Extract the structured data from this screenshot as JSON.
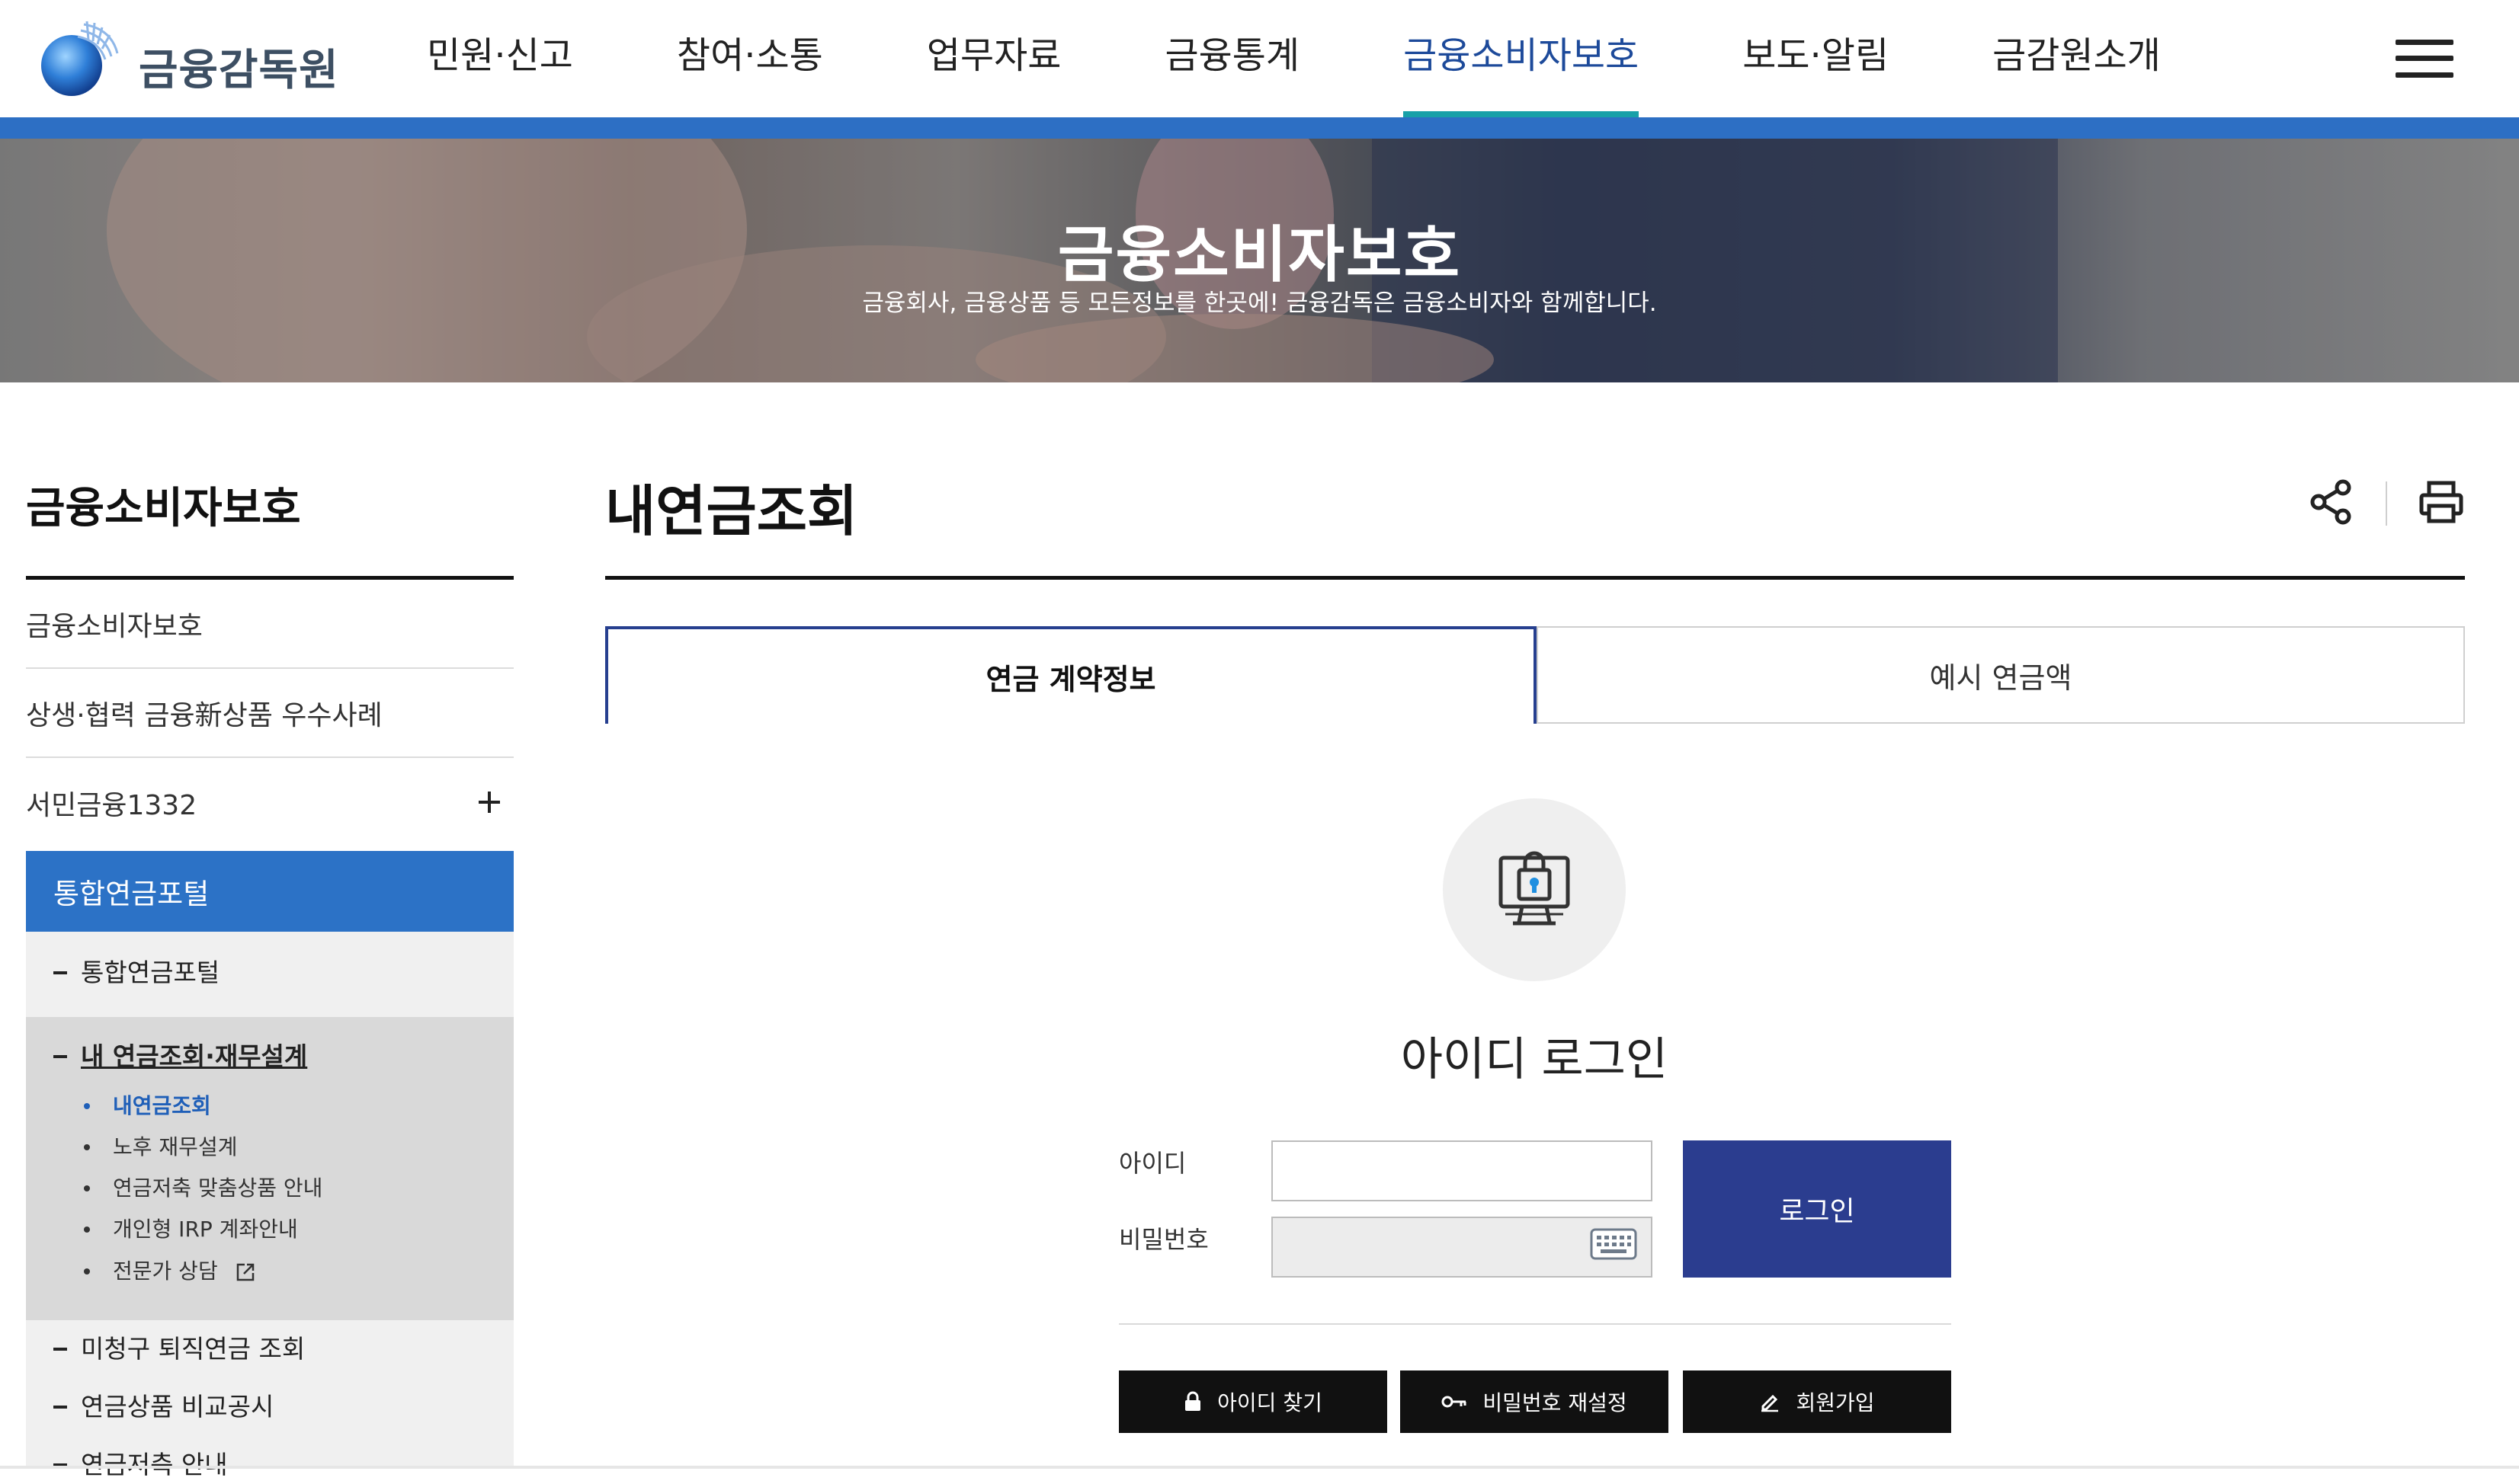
{
  "brand": {
    "name": "금융감독원"
  },
  "nav": {
    "items": [
      "민원·신고",
      "참여·소통",
      "업무자료",
      "금융통계",
      "금융소비자보호",
      "보도·알림",
      "금감원소개"
    ],
    "active_index": 4
  },
  "banner": {
    "title": "금융소비자보호",
    "subtitle": "금융회사, 금융상품 등 모든정보를 한곳에! 금융감독은 금융소비자와 함께합니다."
  },
  "sidebar": {
    "title": "금융소비자보호",
    "items": [
      "금융소비자보호",
      "상생·협력 금융新상품 우수사례",
      "서민금융1332"
    ],
    "active_section": "통합연금포털",
    "sub_items": [
      "통합연금포털",
      "내 연금조회·재무설계"
    ],
    "sub_sub_items": [
      "내연금조회",
      "노후 재무설계",
      "연금저축 맞춤상품 안내",
      "개인형 IRP 계좌안내",
      "전문가 상담"
    ],
    "more_items": [
      "미청구 퇴직연금 조회",
      "연금상품 비교공시",
      "연금저축 안내"
    ]
  },
  "main": {
    "title": "내연금조회",
    "tabs": [
      "연금 계약정보",
      "예시 연금액"
    ],
    "active_tab": 0
  },
  "login": {
    "title": "아이디 로그인",
    "id_label": "아이디",
    "password_label": "비밀번호",
    "id_value": "",
    "password_value": "",
    "login_button": "로그인",
    "find_id": "아이디 찾기",
    "reset_password": "비밀번호 재설정",
    "signup": "회원가입"
  },
  "colors": {
    "brand_blue": "#2d6fc4",
    "active_nav": "#1d4a9a",
    "nav_underline": "#18a0a8",
    "login_button": "#2b3d8f",
    "sidebar_active": "#2c72c6"
  }
}
